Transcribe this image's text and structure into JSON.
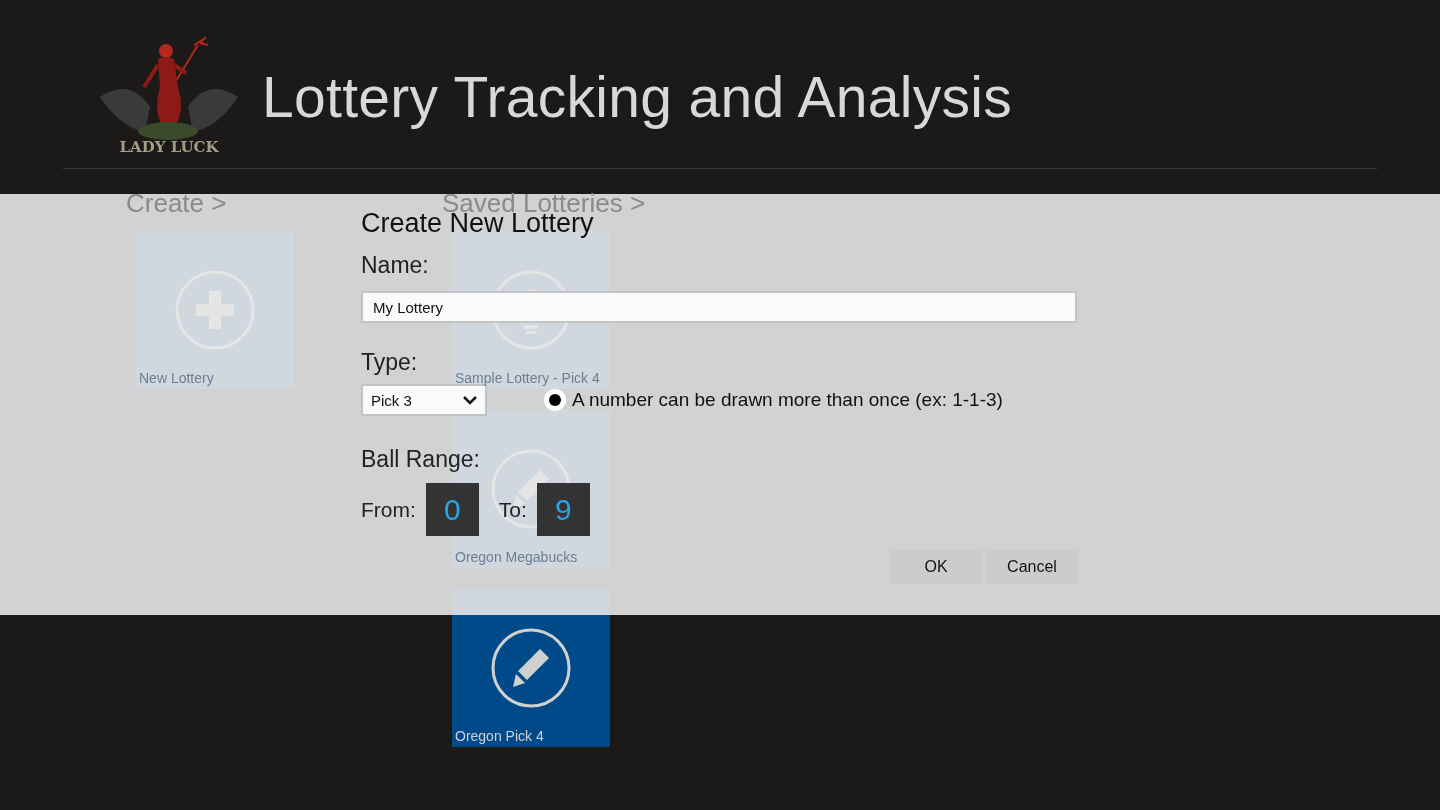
{
  "app": {
    "title": "Lottery Tracking and Analysis",
    "logo_text": "LADY LUCK"
  },
  "sections": [
    {
      "heading": "Create >",
      "tiles": [
        {
          "label": "New Lottery",
          "kind": "plus"
        }
      ]
    },
    {
      "heading": "Saved Lotteries >",
      "tiles": [
        {
          "label": "Sample Lottery - Pick 4",
          "kind": "bulb"
        },
        {
          "label": "Oregon Megabucks",
          "kind": "pencil"
        },
        {
          "label": "Oregon Pick 4",
          "kind": "pencil"
        }
      ]
    }
  ],
  "dialog": {
    "title": "Create New Lottery",
    "name_label": "Name:",
    "name_value": "My Lottery",
    "type_label": "Type:",
    "type_value": "Pick 3",
    "repeat_option": {
      "label": "A number can be drawn more than once (ex: 1-1-3)",
      "selected": true
    },
    "range_label": "Ball Range:",
    "from_label": "From:",
    "from_value": "0",
    "to_label": "To:",
    "to_value": "9",
    "buttons": [
      "OK",
      "Cancel"
    ]
  }
}
